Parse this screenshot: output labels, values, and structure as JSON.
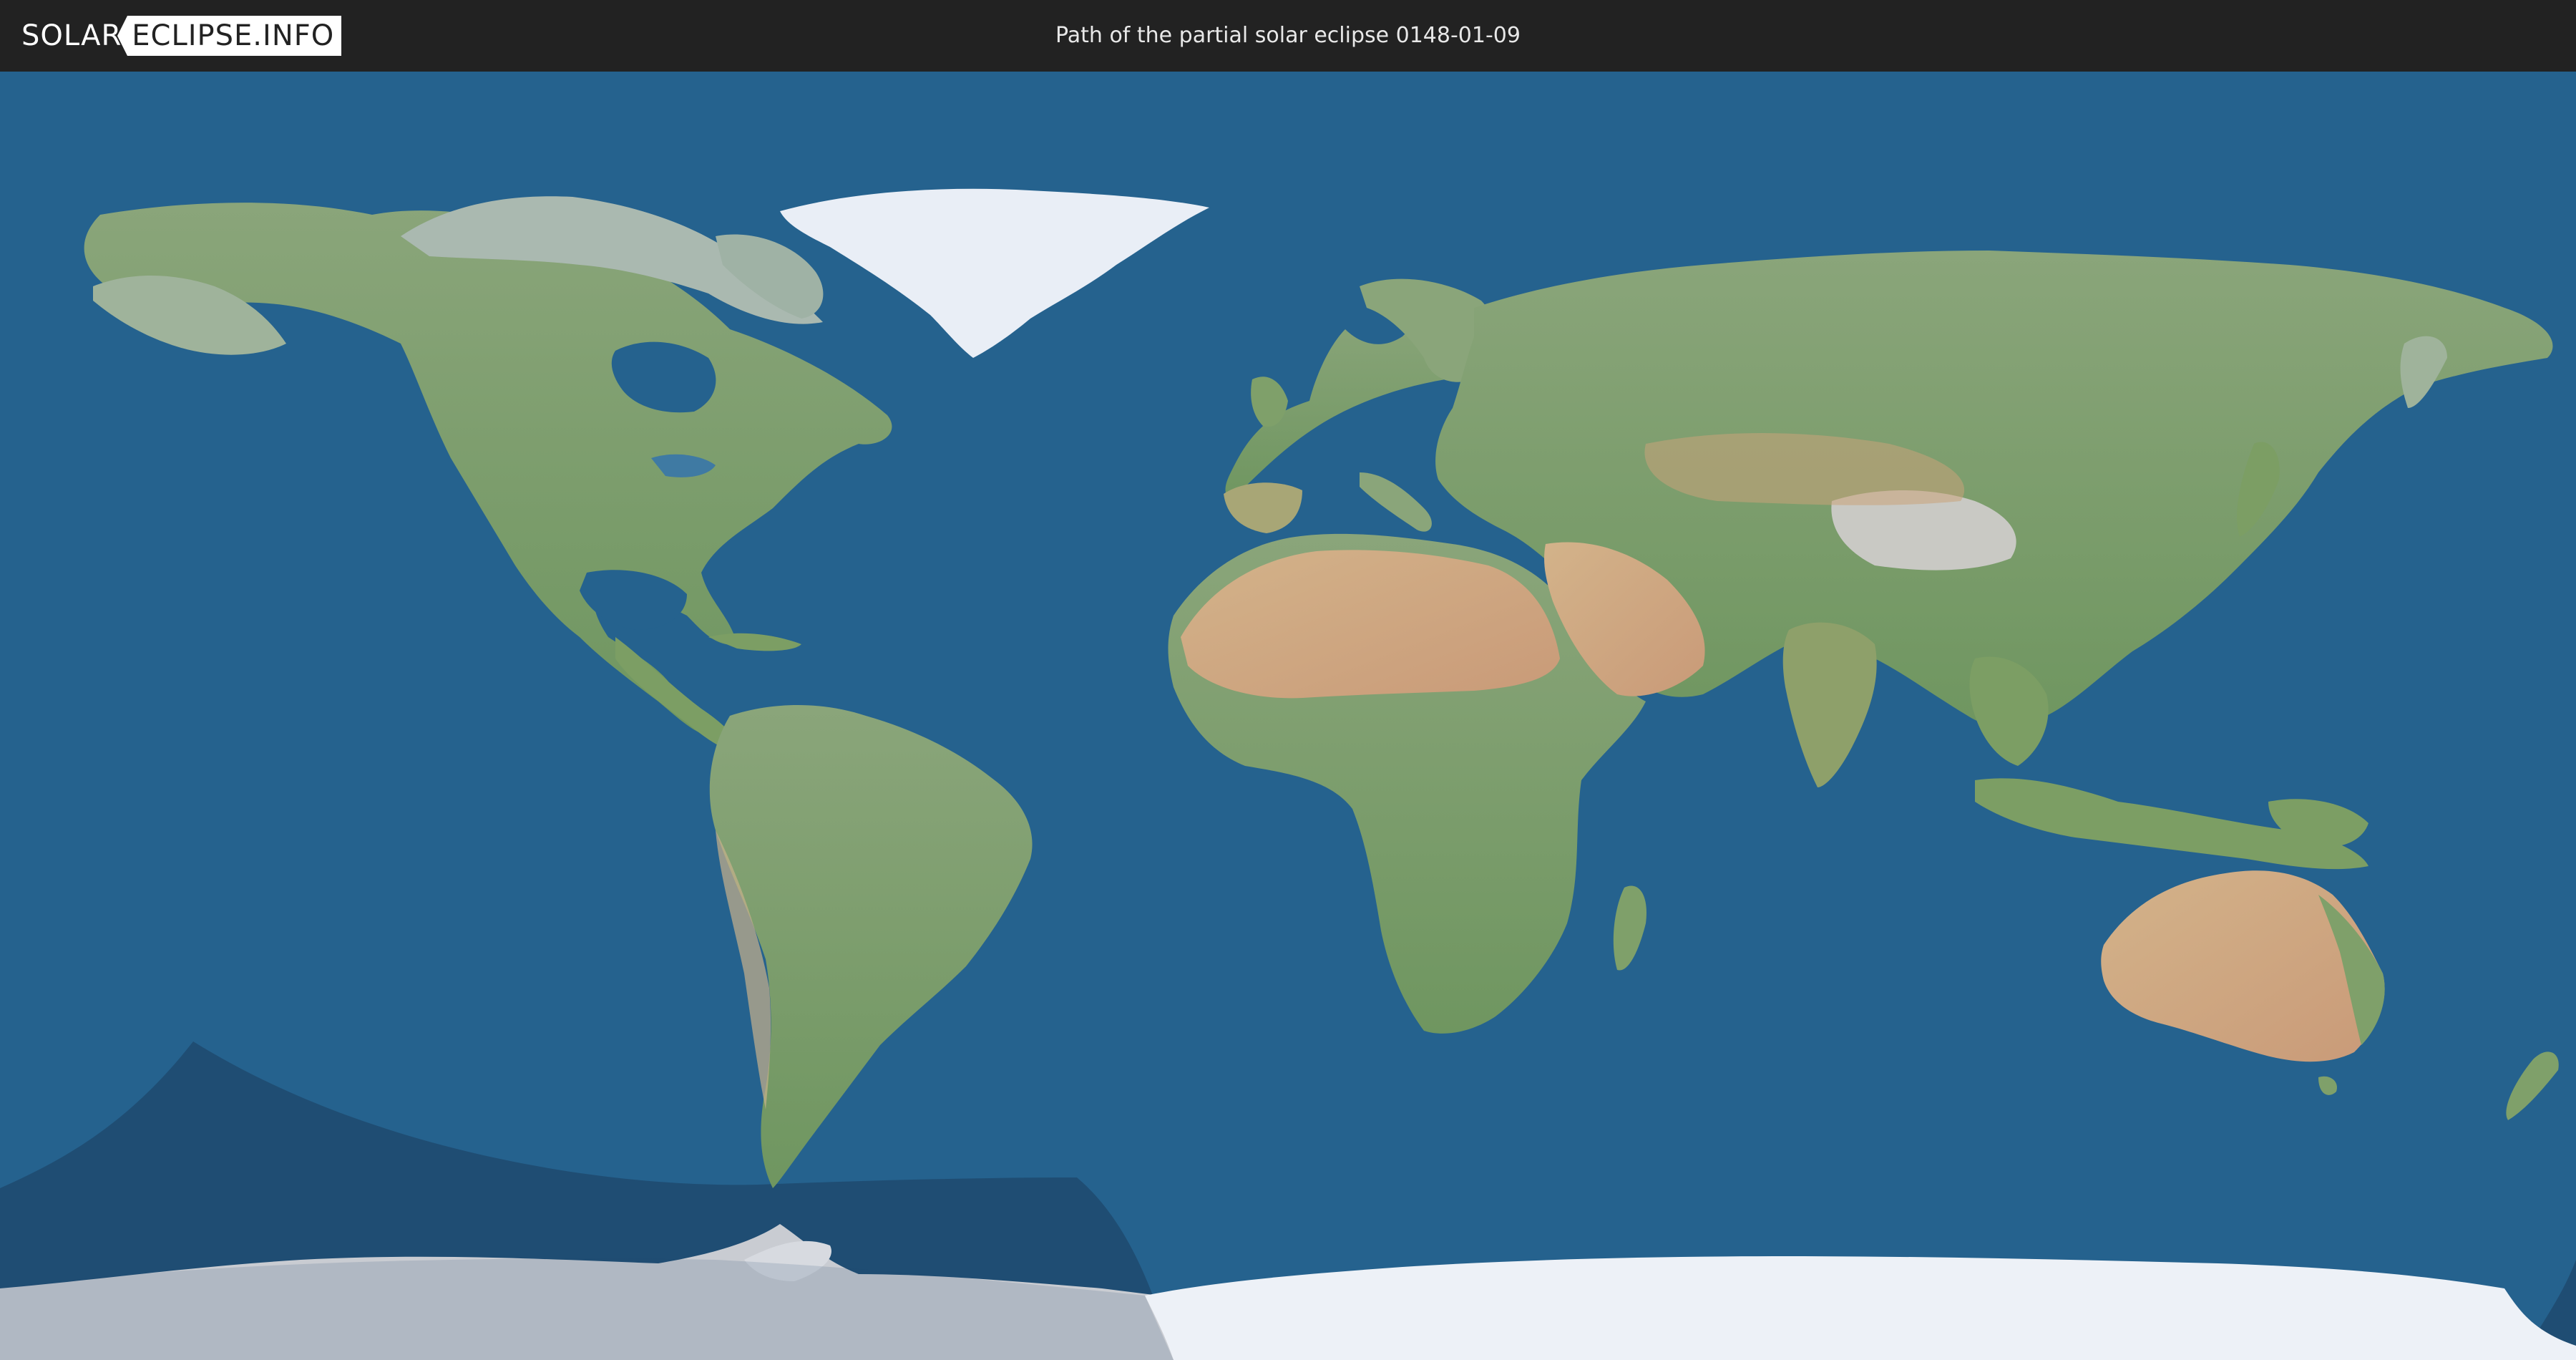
{
  "header": {
    "logo_left": "SOLAR",
    "logo_right": "ECLIPSE.INFO",
    "title": "Path of the partial solar eclipse 0148-01-09"
  },
  "map": {
    "projection": "equirectangular world map",
    "colors": {
      "ocean": "#25628e",
      "land_green": "#7fa06a",
      "land_desert": "#c9a37a",
      "ice": "#e9eef6",
      "antarctica_shadowed": "#c9ccd2",
      "eclipse_shadow": "#1f4a6f"
    }
  }
}
